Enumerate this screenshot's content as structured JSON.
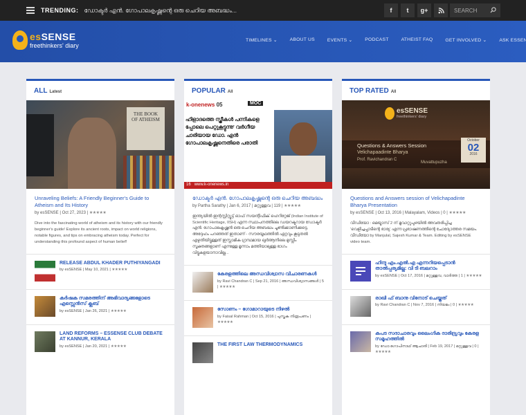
{
  "topbar": {
    "trending_label": "TRENDING:",
    "trending_text": "ഡോക്ടർ എൻ. ഗോപാലകൃഷ്ണന്റെ ഒരു ചെറിയ അബദ്ധം...",
    "social": [
      "f",
      "t",
      "g+",
      "rss"
    ],
    "search_placeholder": "SEARCH"
  },
  "header": {
    "logo_title_a": "es",
    "logo_title_b": "SENSE",
    "logo_sub": "freethinkers' diary",
    "nav": [
      "TIMELINES ⌄",
      "ABOUT US",
      "EVENTS ⌄",
      "PODCAST",
      "ATHEIST FAQ",
      "GET INVOLVED ⌄",
      "ASK ESSENSE ⌄"
    ]
  },
  "col_all": {
    "title": "ALL",
    "sub": "Latest",
    "hero_book_text": "THE BOOK OF ATHEISM",
    "main_title": "Unraveling Beliefs: A Friendly Beginner's Guide to Atheism and Its History",
    "main_meta": "by esSENSE | Oct 27, 2023 |",
    "main_excerpt": "Dive into the fascinating world of atheism and its history with our friendly beginner's guide! Explore its ancient roots, impact on world religions, notable figures, and tips on embracing atheism today. Perfect for understanding this profound aspect of human belief!",
    "items": [
      {
        "title": "RELEASE ABDUL KHADER PUTHIYANGADI",
        "meta": "by esSENSE | May 10, 2021 |"
      },
      {
        "title": "കർഷക സമരത്തിന് അഭിവാദ്യങ്ങളോടെ എസ്സെൻസ് ക്ലബ്",
        "meta": "by esSENSE | Jan 26, 2021 |"
      },
      {
        "title": "LAND REFORMS – ESSENSE CLUB DEBATE AT KANNUR, KERALA",
        "meta": "by esSENSE | Jan 20, 2021 |"
      }
    ]
  },
  "col_popular": {
    "title": "POPULAR",
    "sub": "All",
    "hero_news": "k-onenews",
    "hero_news_num": "05",
    "hero_moc": "MOC",
    "hero_headline": "ഹിളാദത്തെ സ്ത്രീകൾ പന്നികളെ പ്പോലെ പെറ്റുകൂട്ടുന്നു' വർഗീയ ചാരിയായ ഡോ. എൻ ഗോപാലകൃഷ്ണനെതിരെ പരാതി",
    "hero_footer_num": "16",
    "hero_footer_url": "www.k-onenews.in",
    "main_title": "ഡോക്ടർ എൻ. ഗോപാലകൃഷ്ണന്റെ ഒരു ചെറിയ അബദ്ധം",
    "main_meta": "by Partha Sarathy | Jan 6, 2017 | മറ്റുള്ളവ | 119 |",
    "main_excerpt": "ഇന്ത്യയിൽ ഇന്റസ്റ്റിറ്റ്യൂട്ട് ഓഫ് സയന്റിഫിക് ഹെറിറ്റേജ് (Indian Institute of Scientific Heritage, IISH) എന്ന സ്ഥാപനത്തിലെ ഡയറക്ടറായ ഡോക്ടർ എൻ. ഗോപാലകൃഷ്ണൻ ഒരു ചെറിയ അബദ്ധം ചൂണ്ടിക്കാണിക്കട്ടെ. അദ്ദേഹം പറഞ്ഞത് ഇതാണ് - സൗരയൂഥത്തിൽ ഏറ്റവും കൂടുതൽ എഴുതിയിട്ടുള്ളത് ഇസ്ലാമിക ഗ്രന്ഥമായ ഖുർആനിലെ മുസ്ലിം സൂക്തങ്ങളാണ് എന്നുള്ള മൂന്നാം മത്തിയാലുള്ള ഭാഗം വിട്ടുകളയാനാവില്ല...",
    "items": [
      {
        "title": "കേരളത്തിലെ അന്ധവിശ്വാസ വിചാരണകൾ",
        "meta": "by Ravi Chandran C | Sep 21, 2016 | അന്ധവിശ്വാസങ്ങൾ | 5 |"
      },
      {
        "title": "സോണം – ഗോമാറായുടെ നിഴൽ",
        "meta": "by Faisal Rahman | Oct 15, 2016 | പുസ്തക നിരൂപണം |"
      },
      {
        "title": "THE FIRST LAW THERMODYNAMICS",
        "meta": ""
      }
    ]
  },
  "col_top": {
    "title": "TOP RATED",
    "sub": "All",
    "hero_logo_title": "esSENSE",
    "hero_logo_sub": "freethinkers' diary",
    "hero_session": "Questions & Answers Session",
    "hero_session_sub": "Velichapaadinte Bharya",
    "hero_speaker": "Prof. Ravichandran C",
    "hero_place": "Muvattupuzha",
    "hero_month": "October",
    "hero_day": "02",
    "hero_year": "2016",
    "main_title": "Questions and Answers session of Velichapadinte Bharya Presentation",
    "main_meta": "by esSENSE | Oct 13, 2016 | Malayalam, Videos | 0 |",
    "main_excerpt": "വീഡിയോ : മെയ്മാസ് 2 ന് മൂവാറ്റുപുഴയിൽ അവതരിപ്പിച്ച 'വെളിച്ചപ്പാടിന്റെ ഭാര്യ' എന്ന പ്രഭാഷണത്തിന്റെ ചോദ്യോത്തര സമയം. വീഡിയോ by Manjulal, Sajesh Kumar & Team. Editing by esSENSE video team.",
    "items": [
      {
        "title": "ഹിന്ദു എം.എൽ.എ എന്നറിയപ്പെടാൻ താൽപ്പര്യമില്ല: വി ടി ബലറാം",
        "meta": "by esSENSE | Oct 17, 2016 | മറ്റുള്ളവ, വാർത്ത | 1 |"
      },
      {
        "title": "രാഖി ഫ് ബാനു വിനോട് ചെയ്തത്",
        "meta": "by Ravi Chandran C | Nov 7, 2016 | നിയമം | 0 |"
      },
      {
        "title": "കപട സദാചാരവും ലൈംഗിക ദാരിദ്ര്യവും കേരള സമൂഹത്തിൽ",
        "meta": "by ഡോ.ഗോപിനാഥ് ആചാരി | Feb 19, 2017 | മറ്റുള്ളവ | 0 |"
      }
    ]
  },
  "stars": "★★★★★",
  "colors": {
    "accent": "#2757b8",
    "topbar": "#222222",
    "logo_yellow": "#f4b21a"
  }
}
